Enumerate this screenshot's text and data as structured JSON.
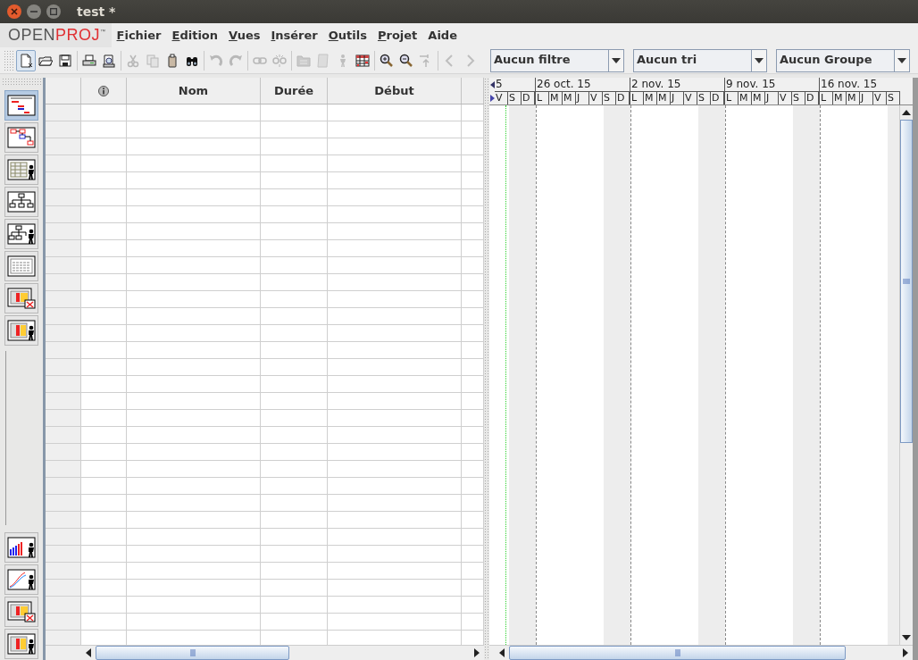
{
  "window": {
    "title": "test *"
  },
  "logo": {
    "part_1": "OPEN",
    "part_2": "PROJ",
    "mark": "™"
  },
  "menu": [
    {
      "label": "Fichier",
      "mnemonic": true
    },
    {
      "label": "Edition",
      "mnemonic": true
    },
    {
      "label": "Vues",
      "mnemonic": true
    },
    {
      "label": "Insérer",
      "mnemonic": true
    },
    {
      "label": "Outils",
      "mnemonic": true
    },
    {
      "label": "Projet",
      "mnemonic": true
    },
    {
      "label": "Aide",
      "mnemonic": false
    }
  ],
  "toolbar_groups": [
    [
      {
        "disabled": false,
        "selected": true
      },
      {
        "disabled": false,
        "selected": false
      },
      {
        "disabled": false,
        "selected": false
      }
    ],
    [
      {
        "disabled": false,
        "selected": false
      },
      {
        "disabled": false,
        "selected": false
      }
    ],
    [
      {
        "disabled": true,
        "selected": false
      },
      {
        "disabled": true,
        "selected": false
      },
      {
        "disabled": false,
        "selected": false
      },
      {
        "disabled": false,
        "selected": false
      }
    ],
    [
      {
        "disabled": true,
        "selected": false
      },
      {
        "disabled": true,
        "selected": false
      }
    ],
    [
      {
        "disabled": true,
        "selected": false
      },
      {
        "disabled": true,
        "selected": false
      }
    ],
    [
      {
        "disabled": true,
        "selected": false
      },
      {
        "disabled": true,
        "selected": false
      },
      {
        "disabled": true,
        "selected": false
      },
      {
        "disabled": false,
        "selected": false
      }
    ],
    [
      {
        "disabled": false,
        "selected": false
      },
      {
        "disabled": false,
        "selected": false
      },
      {
        "disabled": true,
        "selected": false
      }
    ],
    [
      {
        "disabled": true,
        "selected": false
      },
      {
        "disabled": true,
        "selected": false
      }
    ]
  ],
  "selectors": [
    {
      "value": "Aucun filtre"
    },
    {
      "value": "Aucun tri"
    },
    {
      "value": "Aucun Groupe"
    }
  ],
  "view_buttons": [
    {
      "selected": true
    },
    {
      "selected": false
    },
    {
      "selected": false
    },
    {
      "selected": false
    },
    {
      "selected": false
    },
    {
      "selected": false
    },
    {
      "selected": false
    },
    {
      "selected": false
    }
  ],
  "bottom_view_buttons": [
    {
      "selected": false
    },
    {
      "selected": false
    },
    {
      "selected": false
    },
    {
      "selected": false
    }
  ],
  "table": {
    "columns": [
      "Nom",
      "Durée",
      "Début"
    ]
  },
  "gantt": {
    "weeks": [
      {
        "label": "5",
        "days": [
          {
            "label": "V",
            "weekend": false
          },
          {
            "label": "S",
            "weekend": true
          },
          {
            "label": "D",
            "weekend": true
          }
        ]
      },
      {
        "label": "26 oct. 15",
        "days": [
          {
            "label": "L",
            "weekend": false
          },
          {
            "label": "M",
            "weekend": false
          },
          {
            "label": "M",
            "weekend": false
          },
          {
            "label": "J",
            "weekend": false
          },
          {
            "label": "V",
            "weekend": false
          },
          {
            "label": "S",
            "weekend": true
          },
          {
            "label": "D",
            "weekend": true
          }
        ]
      },
      {
        "label": "2 nov. 15",
        "days": [
          {
            "label": "L",
            "weekend": false
          },
          {
            "label": "M",
            "weekend": false
          },
          {
            "label": "M",
            "weekend": false
          },
          {
            "label": "J",
            "weekend": false
          },
          {
            "label": "V",
            "weekend": false
          },
          {
            "label": "S",
            "weekend": true
          },
          {
            "label": "D",
            "weekend": true
          }
        ]
      },
      {
        "label": "9 nov. 15",
        "days": [
          {
            "label": "L",
            "weekend": false
          },
          {
            "label": "M",
            "weekend": false
          },
          {
            "label": "M",
            "weekend": false
          },
          {
            "label": "J",
            "weekend": false
          },
          {
            "label": "V",
            "weekend": false
          },
          {
            "label": "S",
            "weekend": true
          },
          {
            "label": "D",
            "weekend": true
          }
        ]
      },
      {
        "label": "16 nov. 15",
        "days": [
          {
            "label": "L",
            "weekend": false
          },
          {
            "label": "M",
            "weekend": false
          },
          {
            "label": "M",
            "weekend": false
          },
          {
            "label": "J",
            "weekend": false
          },
          {
            "label": "V",
            "weekend": false
          },
          {
            "label": "S",
            "weekend": true
          }
        ]
      }
    ]
  }
}
